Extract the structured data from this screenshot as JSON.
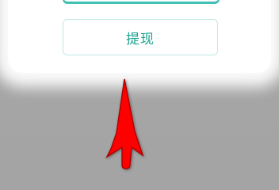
{
  "dialog": {
    "withdraw_button_label": "提现"
  },
  "annotation": {
    "arrow_color": "#ff0000",
    "arrow_icon": "up-arrow-icon"
  }
}
